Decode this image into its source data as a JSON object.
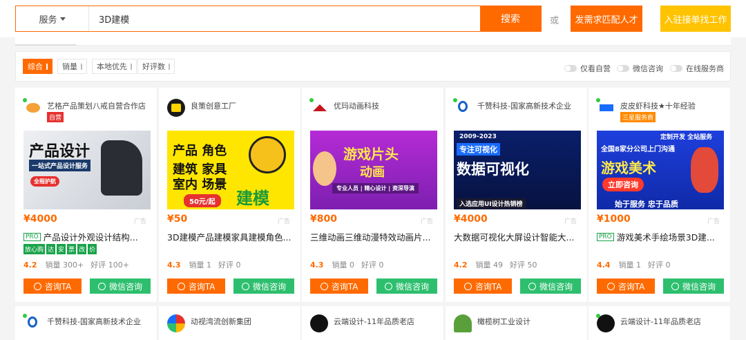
{
  "search": {
    "category": "服务",
    "query": "3D建模",
    "button": "搜索",
    "or": "或",
    "post_btn": "发需求匹配人才",
    "join_btn": "入驻接单找工作"
  },
  "filters": {
    "sorts": [
      "综合",
      "销量",
      "本地优先",
      "好评数"
    ],
    "toggles": [
      "仅看自营",
      "微信咨询",
      "在线服务商"
    ]
  },
  "cards": [
    {
      "shop": "艺格产品策划八戒自营合作店",
      "tag": "自营",
      "banner_lines": [
        "产品设计",
        "一站式产品设计服务",
        "全程护航"
      ],
      "price": "¥4000",
      "ad": "广告",
      "pro": "PRO",
      "title": "产品设计外观设计结构...",
      "perks": [
        "放心购",
        "达",
        "安",
        "票",
        "改",
        "价"
      ],
      "rating": "4.2",
      "sales": "销量  300+",
      "reviews": "好评  100+",
      "btn_consult": "咨询TA",
      "btn_wechat": "微信咨询"
    },
    {
      "shop": "良策创意工厂",
      "banner_lines": [
        "产品  角色",
        "建筑  家具",
        "室内  场景",
        "50元/起",
        "建模"
      ],
      "price": "¥50",
      "ad": "广告",
      "title": "3D建模产品建模家具建模角色...",
      "rating": "4.3",
      "sales": "销量  1",
      "reviews": "好评  0",
      "btn_consult": "咨询TA",
      "btn_wechat": "微信咨询"
    },
    {
      "shop": "优玛动画科技",
      "banner_lines": [
        "游戏片头",
        "动画",
        "专业人员 | 精心设计 | 资深导演"
      ],
      "price": "¥800",
      "ad": "广告",
      "title": "三维动画三维动漫特效动画片...",
      "rating": "4.3",
      "sales": "销量  0",
      "reviews": "好评  0",
      "btn_consult": "咨询TA",
      "btn_wechat": "微信咨询"
    },
    {
      "shop": "千赞科技-国家高新技术企业",
      "banner_lines": [
        "2009-2023",
        "专注可视化",
        "数据可视化",
        "入选应用UI设计热销榜"
      ],
      "price": "¥4000",
      "ad": "广告",
      "title": "大数据可视化大屏设计智能大...",
      "rating": "4.2",
      "sales": "销量  49",
      "reviews": "好评  50",
      "btn_consult": "咨询TA",
      "btn_wechat": "微信咨询"
    },
    {
      "shop": "皮皮虾科技★十年经验",
      "tag": "三星服务商",
      "banner_lines": [
        "定制开发 全站服务",
        "全国8家分公司上门沟通",
        "游戏美术",
        "立即咨询",
        "始于服务  忠于品质"
      ],
      "price": "¥1000",
      "ad": "广告",
      "pro": "PRO",
      "title": "游戏美术手绘场景3D建...",
      "rating": "4.4",
      "sales": "销量  1",
      "reviews": "好评  0",
      "btn_consult": "咨询TA",
      "btn_wechat": "微信咨询"
    }
  ],
  "row2": [
    "千赞科技-国家高新技术企业",
    "动视湾流创新集团",
    "云端设计-11年品质老店",
    "橄榄树工业设计",
    "云端设计-11年品质老店"
  ]
}
